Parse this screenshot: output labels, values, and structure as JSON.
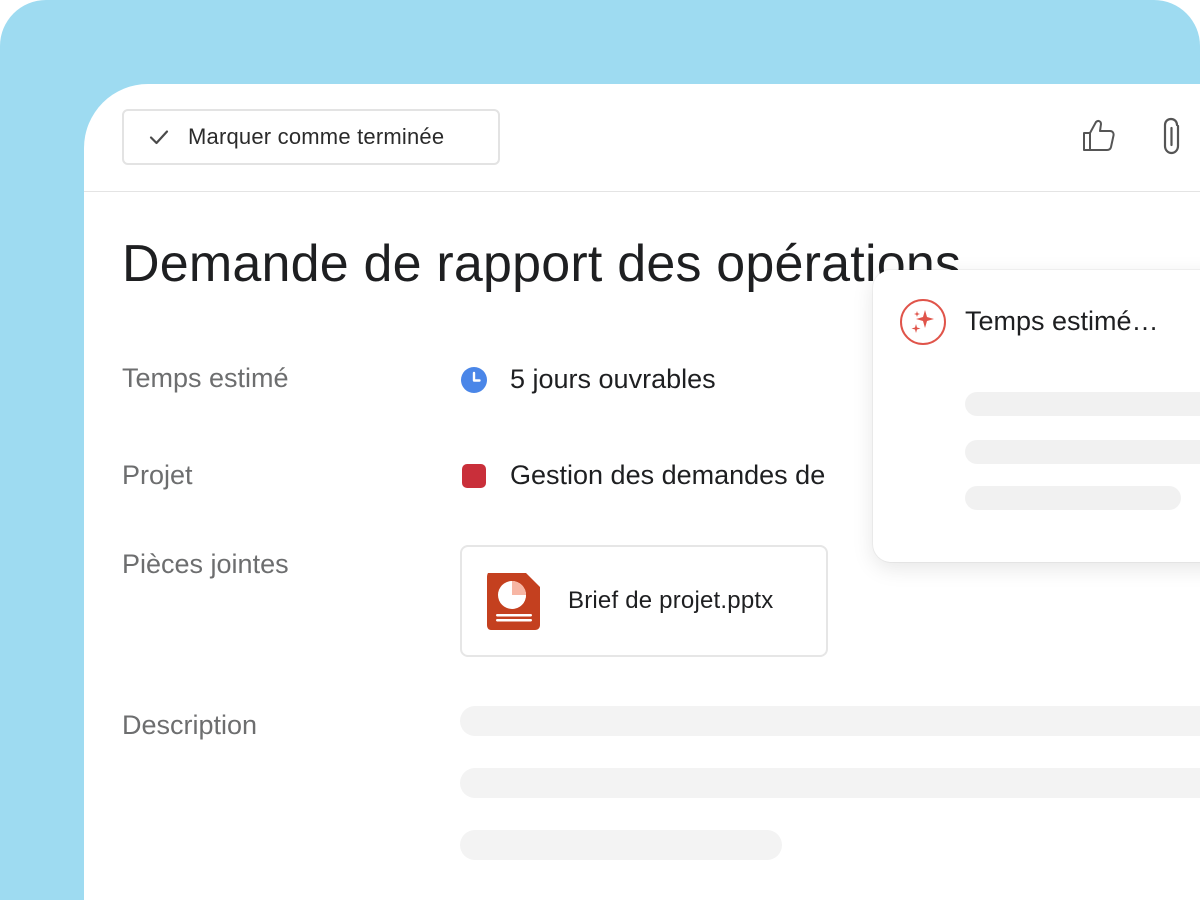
{
  "toolbar": {
    "complete_label": "Marquer comme terminée",
    "check_icon": "check-icon",
    "like_icon": "thumbs-up-icon",
    "attach_icon": "paperclip-icon"
  },
  "task": {
    "title": "Demande de rapport des opérations"
  },
  "fields": {
    "estimated_time": {
      "label": "Temps estimé",
      "value": "5 jours ouvrables",
      "icon": "clock-icon"
    },
    "project": {
      "label": "Projet",
      "value": "Gestion des demandes de",
      "icon": "project-color-square"
    },
    "attachments": {
      "label": "Pièces jointes",
      "files": [
        {
          "name": "Brief de projet.pptx",
          "icon": "pptx-file-icon"
        }
      ]
    },
    "description": {
      "label": "Description"
    }
  },
  "ai_popup": {
    "title": "Temps estimé…",
    "icon": "ai-sparkle-icon"
  },
  "colors": {
    "backdrop": "#9edbf1",
    "clock": "#4a86e8",
    "project": "#c92f3a",
    "pptx": "#c4401f",
    "ai_accent": "#e0544a"
  }
}
